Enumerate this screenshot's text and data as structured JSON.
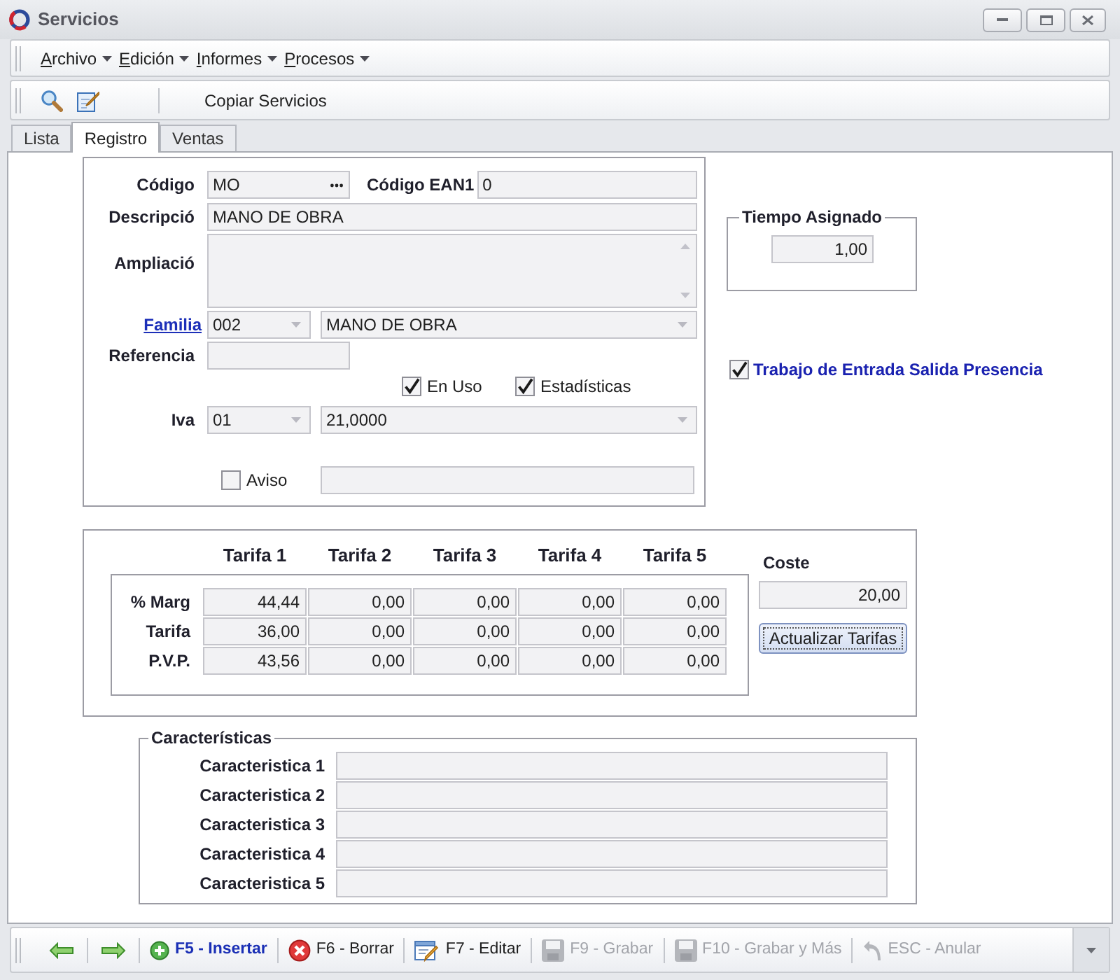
{
  "window": {
    "title": "Servicios"
  },
  "menu": [
    {
      "label": "Archivo"
    },
    {
      "label": "Edición"
    },
    {
      "label": "Informes"
    },
    {
      "label": "Procesos"
    }
  ],
  "toolbar": {
    "buttons": [
      {
        "label": "Copiar Servicios"
      }
    ]
  },
  "tabs": [
    {
      "label": "Lista",
      "selected": false
    },
    {
      "label": "Registro",
      "selected": true
    },
    {
      "label": "Ventas",
      "selected": false
    }
  ],
  "form": {
    "codigo": {
      "label": "Código",
      "value": "MO"
    },
    "ean": {
      "label": "Código EAN1",
      "value": "0"
    },
    "descripcion": {
      "label": "Descripció",
      "value": "MANO DE OBRA"
    },
    "ampliacion": {
      "label": "Ampliació"
    },
    "familia": {
      "label": "Familia",
      "code": "002",
      "name": "MANO DE OBRA"
    },
    "referencia": {
      "label": "Referencia"
    },
    "flags": [
      {
        "label": "En Uso",
        "checked": true
      },
      {
        "label": "Estadísticas",
        "checked": true
      }
    ],
    "iva": {
      "label": "Iva",
      "code": "01",
      "rate": "21,0000"
    },
    "aviso": {
      "label": "Aviso",
      "checked": false
    }
  },
  "tiempo_asignado": {
    "legend": "Tiempo Asignado",
    "value": "1,00"
  },
  "presencia": {
    "label": "Trabajo de Entrada Salida Presencia",
    "checked": true
  },
  "tarifas": {
    "columns": [
      "Tarifa 1",
      "Tarifa 2",
      "Tarifa 3",
      "Tarifa 4",
      "Tarifa 5"
    ],
    "rows": [
      {
        "label": "% Marg",
        "values": [
          "44,44",
          "0,00",
          "0,00",
          "0,00",
          "0,00"
        ]
      },
      {
        "label": "Tarifa",
        "values": [
          "36,00",
          "0,00",
          "0,00",
          "0,00",
          "0,00"
        ]
      },
      {
        "label": "P.V.P.",
        "values": [
          "43,56",
          "0,00",
          "0,00",
          "0,00",
          "0,00"
        ]
      }
    ],
    "coste": {
      "label": "Coste",
      "value": "20,00"
    },
    "button": "Actualizar Tarifas"
  },
  "caracteristicas": {
    "legend": "Características",
    "rows": [
      {
        "label": "Caracteristica 1"
      },
      {
        "label": "Caracteristica 2"
      },
      {
        "label": "Caracteristica 3"
      },
      {
        "label": "Caracteristica 4"
      },
      {
        "label": "Caracteristica 5"
      }
    ]
  },
  "actions": [
    {
      "kind": "back",
      "disabled": false
    },
    {
      "kind": "forward",
      "disabled": false
    },
    {
      "kind": "insert",
      "label": "F5 - Insertar",
      "default": true,
      "disabled": false
    },
    {
      "kind": "delete",
      "label": "F6 - Borrar",
      "default": false,
      "disabled": false
    },
    {
      "kind": "edit",
      "label": "F7 - Editar",
      "default": false,
      "disabled": false
    },
    {
      "kind": "save",
      "label": "F9 - Grabar",
      "default": false,
      "disabled": true
    },
    {
      "kind": "save_more",
      "label": "F10 - Grabar y Más",
      "default": false,
      "disabled": true
    },
    {
      "kind": "undo",
      "label": "ESC - Anular",
      "default": false,
      "disabled": true
    }
  ]
}
